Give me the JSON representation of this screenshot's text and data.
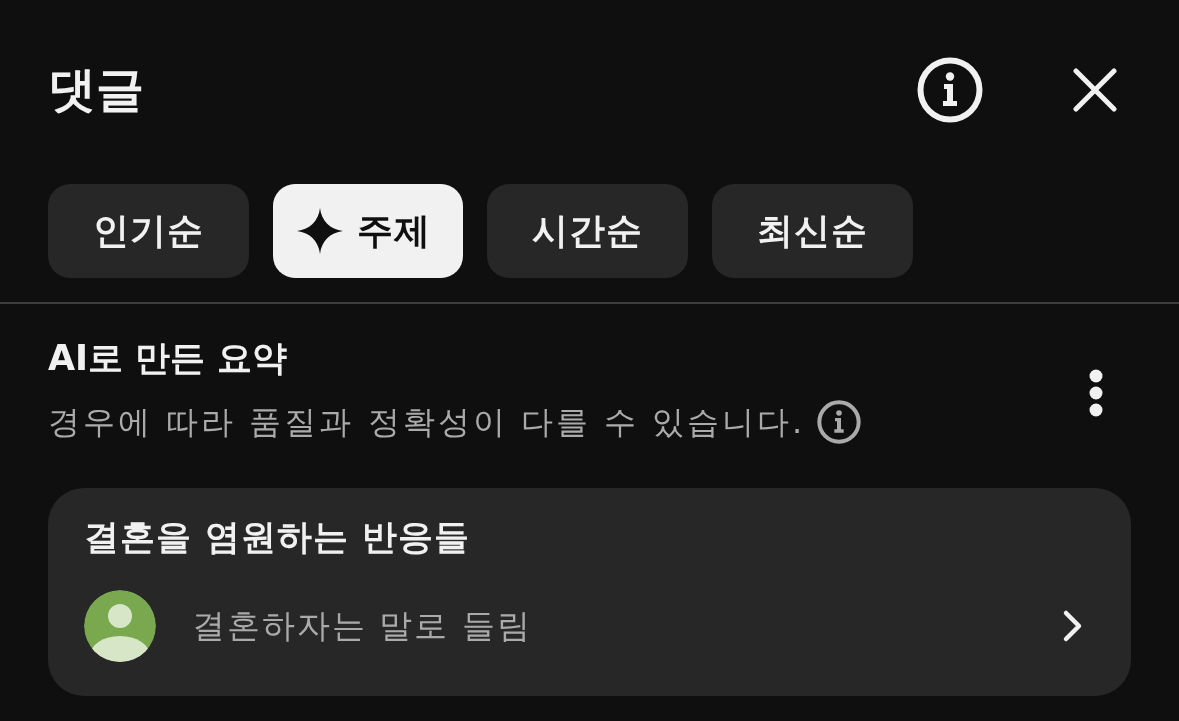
{
  "header": {
    "title": "댓글"
  },
  "tabs": [
    {
      "label": "인기순",
      "kind": "text",
      "selected": false
    },
    {
      "label": "주제",
      "kind": "ai",
      "selected": true
    },
    {
      "label": "시간순",
      "kind": "text",
      "selected": false
    },
    {
      "label": "최신순",
      "kind": "text",
      "selected": false
    }
  ],
  "summary": {
    "title": "AI로 만든 요약",
    "note": "경우에 따라 품질과 정확성이 다를 수 있습니다."
  },
  "topics": [
    {
      "title": "결혼을 염원하는 반응들",
      "comment": "결혼하자는 말로 들림"
    }
  ]
}
